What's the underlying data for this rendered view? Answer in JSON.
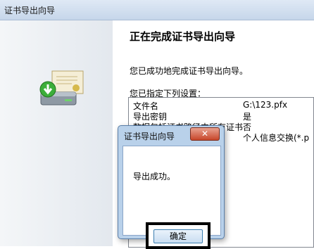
{
  "window": {
    "title": "证书导出向导"
  },
  "wizard": {
    "heading": "正在完成证书导出向导",
    "success_message": "您已成功地完成证书导出向导。",
    "settings_label": "您已指定下列设置：",
    "settings": [
      {
        "key": "文件名",
        "value": "G:\\123.pfx"
      },
      {
        "key": "导出密钥",
        "value": "是"
      },
      {
        "key": "数据包括证书路径中所有证书",
        "value": "否"
      },
      {
        "key": "",
        "value": "个人信息交换(*.p"
      }
    ]
  },
  "dialog": {
    "title": "证书导出向导",
    "close_label": "✕",
    "message": "导出成功。",
    "ok_label": "确定"
  }
}
